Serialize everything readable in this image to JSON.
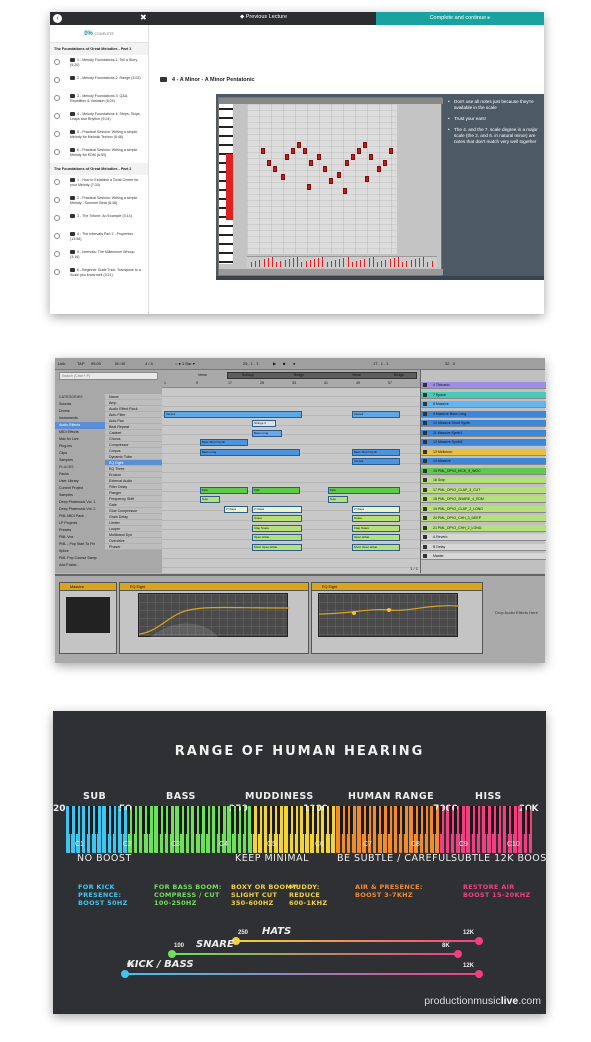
{
  "course_player": {
    "previous_label": "◆ Previous Lecture",
    "complete_label": "Complete and continue ▸",
    "progress_value": "0%",
    "progress_suffix": "COMPLETE",
    "sections": [
      {
        "title": "The Foundations of Great Melodies - Part 1",
        "items": [
          "1 - Melody Foundations 1: Tell a Story (5:20)",
          "2 - Melody Foundations 2: Range (3:02)",
          "3 - Melody Foundations 3: Q&A, Repetition & Variation (6:24)",
          "4 - Melody Foundations 4: Steps, Skips, Leaps and Rhythm (9:24)",
          "5 - Practical Session: Writing a simple Melody for Melodic Techno (6:46)",
          "6 - Practical Session: Writing a simple Melody for EDM (6:59)"
        ]
      },
      {
        "title": "The Foundations of Great Melodies - Part 2",
        "items": [
          "1 - How to Establish a Tonal Center for your Melody (7:34)",
          "2 - Practical Session: Writing a simple Melody - Summer Beat (6:48)",
          "3 - The Tritone: An Example (3:14)",
          "4 - The Intervals Part 2 - Properties (13:58)",
          "5 - Intervals: The Millennium Whoop (3:16)",
          "6 - Beginner Scale Trick: Transpose to a Scale you know well (3:21)"
        ]
      }
    ],
    "lecture_title": "4 - A Minor - A Minor Pentatonic",
    "video_tips": [
      "Don't use all notes just because they're available in the scale",
      "Trust your ears!",
      "The 4. and the 7. scale degree in a major scale (the 2. and 6. in natural minor) are notes that don't match very well together"
    ]
  },
  "ableton": {
    "topbar": [
      "Link",
      "TAP",
      "95.00",
      "IIII IIII",
      "4 / 4",
      "○ ● 1 Bar ▾",
      "25 . 1 . 1",
      "▶",
      "■",
      "●",
      "17 . 1 . 1",
      "32 . 0"
    ],
    "search_placeholder": "Search (Cmd + F)",
    "categories": [
      {
        "label": "CATEGORIES",
        "header": true
      },
      {
        "label": "Sounds"
      },
      {
        "label": "Drums"
      },
      {
        "label": "Instruments"
      },
      {
        "label": "Audio Effects",
        "selected": true
      },
      {
        "label": "MIDI Effects"
      },
      {
        "label": "Max for Live"
      },
      {
        "label": "Plug-ins"
      },
      {
        "label": "Clips"
      },
      {
        "label": "Samples"
      },
      {
        "label": "PLACES",
        "header": true
      },
      {
        "label": "Packs"
      },
      {
        "label": "User Library"
      },
      {
        "label": "Current Project"
      },
      {
        "label": "Samples"
      },
      {
        "label": "Deep Phatmusic Vol. 1"
      },
      {
        "label": "Deep Phatmusic Vol. 2"
      },
      {
        "label": "PML MIDI Pack"
      },
      {
        "label": "LP Projects"
      },
      {
        "label": "Presets"
      },
      {
        "label": "PML Vox"
      },
      {
        "label": "PML - Pop Start To Fin"
      },
      {
        "label": "Splice"
      },
      {
        "label": "PML Pop Course Samp"
      },
      {
        "label": "Add Folder..."
      }
    ],
    "browser_names": [
      {
        "label": "Name"
      },
      {
        "label": "Amp"
      },
      {
        "label": "Audio Effect Rack"
      },
      {
        "label": "Auto Filter"
      },
      {
        "label": "Auto Pan"
      },
      {
        "label": "Beat Repeat"
      },
      {
        "label": "Cabinet"
      },
      {
        "label": "Chorus"
      },
      {
        "label": "Compressor"
      },
      {
        "label": "Corpus"
      },
      {
        "label": "Dynamic Tube"
      },
      {
        "label": "EQ Eight",
        "selected": true
      },
      {
        "label": "EQ Three"
      },
      {
        "label": "Erosion"
      },
      {
        "label": "External Audio"
      },
      {
        "label": "Filter Delay"
      },
      {
        "label": "Flanger"
      },
      {
        "label": "Frequency Shift"
      },
      {
        "label": "Gate"
      },
      {
        "label": "Glue Compressor"
      },
      {
        "label": "Grain Delay"
      },
      {
        "label": "Limiter"
      },
      {
        "label": "Looper"
      },
      {
        "label": "Multiband Dyn"
      },
      {
        "label": "Overdrive"
      },
      {
        "label": "Phaser"
      }
    ],
    "markers": [
      "Verse",
      "Buildup",
      "Bridge",
      "Verse",
      "Bridge"
    ],
    "ruler_numbers": [
      "1",
      "9",
      "17",
      "25",
      "33",
      "41",
      "49",
      "57",
      "65"
    ],
    "clips": {
      "verse1": "Verse1",
      "verse2": "Verse2",
      "strings": "Strings 3",
      "bass_long1": "Bass Long",
      "bass_long2": "Bass Long",
      "bass_short1": "Bass Short Synth",
      "bass_short2": "Bass Short Synth",
      "verse3": "Verse3",
      "kick1": "Kick",
      "kick2": "Kick",
      "kick3": "Kick",
      "snip1": "Snip",
      "snip2": "Snip",
      "clap1": "2 Claps",
      "clap2": "2 Claps",
      "clap3": "2 Claps",
      "snare1": "Snare",
      "snare2": "Snare",
      "crash1": "Clap Snare",
      "crash2": "Clap Snare",
      "hihat1": "Open Hihat",
      "hihat2": "Open Hihat",
      "hihat3": "Short Open Hihat",
      "hihat4": "Short Open Hihat"
    },
    "tracks": [
      {
        "name": "4 Tibicasio",
        "color": "#9b8ee6"
      },
      {
        "name": "7 Space",
        "color": "#48c8b8"
      },
      {
        "name": "8 Massive",
        "color": "#63b6ef"
      },
      {
        "name": "9 Massive Bass Long",
        "color": "#3d86d8"
      },
      {
        "name": "10 Massive Short Synth",
        "color": "#3d86d8"
      },
      {
        "name": "11 Massive Synth1",
        "color": "#3d86d8"
      },
      {
        "name": "12 Massive Synth2",
        "color": "#3d86d8"
      },
      {
        "name": "13 Mellotron",
        "color": "#e6c23c"
      },
      {
        "name": "14 Massive",
        "color": "#3d86d8"
      },
      {
        "name": "15 PML_DPV2_KICK_5_WOC",
        "color": "#5ec94a"
      },
      {
        "name": "16 Snip",
        "color": "#b6e07a"
      },
      {
        "name": "17 PML_DPV2_CLAP_3_CUT",
        "color": "#b6e07a"
      },
      {
        "name": "18 PML_DPV2_SNARE_4_EDM",
        "color": "#b6e07a"
      },
      {
        "name": "19 PML_DPV2_CLAP_2_LONG",
        "color": "#b6e07a"
      },
      {
        "name": "20 PML_DPV2_CHH_3_DEEP",
        "color": "#b6e07a"
      },
      {
        "name": "21 PML_DPV2_CHH_2_LONG",
        "color": "#b6e07a"
      },
      {
        "name": "A Reverb",
        "color": "#d7d7d7"
      },
      {
        "name": "B Delay",
        "color": "#d7d7d7"
      },
      {
        "name": "Master",
        "color": "#d7d7d7"
      }
    ],
    "devices": {
      "instrument": "Massive",
      "eq1": "EQ Eight",
      "eq2": "EQ Eight",
      "hint": "Drop Audio Effects Here"
    },
    "page_indicator": "1 / 1"
  },
  "hearing_chart": {
    "title": "RANGE OF HUMAN HEARING",
    "bands": [
      "SUB",
      "BASS",
      "MUDDINESS",
      "HUMAN RANGE",
      "HISS"
    ],
    "axis_freqs": [
      "20",
      "50",
      "250",
      "1000",
      "7000",
      "20K"
    ],
    "notes": [
      "C1",
      "C2",
      "C3",
      "C4",
      "C5",
      "C6",
      "C7",
      "C8",
      "C9",
      "C10"
    ],
    "advice": [
      "NO BOOST",
      "KEEP MINIMAL",
      "BE SUBTLE / CAREFUL",
      "SUBTLE 12K BOOST"
    ],
    "tips": [
      {
        "text": "FOR KICK\nPRESENCE:\nBOOST 50HZ",
        "color": "#3dc6f2"
      },
      {
        "text": "FOR BASS BOOM:\nCOMPRESS / CUT\n100-250HZ",
        "color": "#6fe05a"
      },
      {
        "text": "BOXY OR BOOMY:\nSLIGHT CUT\n350-600HZ",
        "color": "#f2d33a"
      },
      {
        "text": "MUDDY:\nREDUCE\n600-1KHZ",
        "color": "#f2d33a"
      },
      {
        "text": "AIR & PRESENCE:\nBOOST 3-7KHZ",
        "color": "#f28b2e"
      },
      {
        "text": "RESTORE AIR\nBOOST 15-20KHZ",
        "color": "#f2407f"
      }
    ],
    "ranges": [
      {
        "label": "HATS",
        "low": "250",
        "high": "12K",
        "color_lo": "#f2d33a",
        "color_hi": "#f2407f"
      },
      {
        "label": "SNARE",
        "low": "100",
        "high": "8K",
        "color_lo": "#6fe05a",
        "color_hi": "#f2407f"
      },
      {
        "label": "KICK / BASS",
        "low": "50",
        "high": "12K",
        "color_lo": "#3dc6f2",
        "color_hi": "#f2407f"
      }
    ],
    "brand_plain": "productionmusic",
    "brand_bold": "live",
    "brand_tld": ".com"
  }
}
